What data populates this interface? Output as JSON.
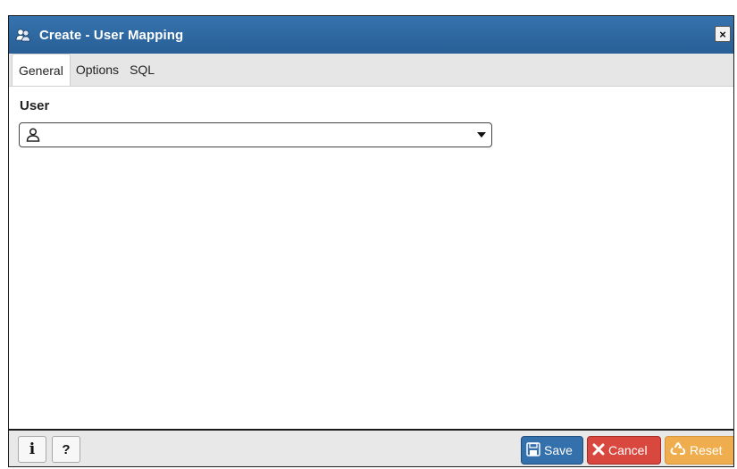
{
  "dialog": {
    "title": "Create - User Mapping",
    "close_label": "×",
    "title_icon": "user-mapping-icon",
    "colors": {
      "titlebar": "#2c6aa6",
      "save": "#3470ab",
      "cancel": "#d9483f",
      "reset": "#f0ad4e"
    }
  },
  "tabs": [
    {
      "label": "General",
      "active": true
    },
    {
      "label": "Options",
      "active": false
    },
    {
      "label": "SQL",
      "active": false
    }
  ],
  "form": {
    "user_label": "User",
    "user_value": "",
    "user_icon": "user-icon",
    "dropdown_icon": "chevron-down-icon"
  },
  "footer": {
    "info_label": "i",
    "help_label": "?",
    "save_label": "Save",
    "cancel_label": "Cancel",
    "reset_label": "Reset"
  }
}
